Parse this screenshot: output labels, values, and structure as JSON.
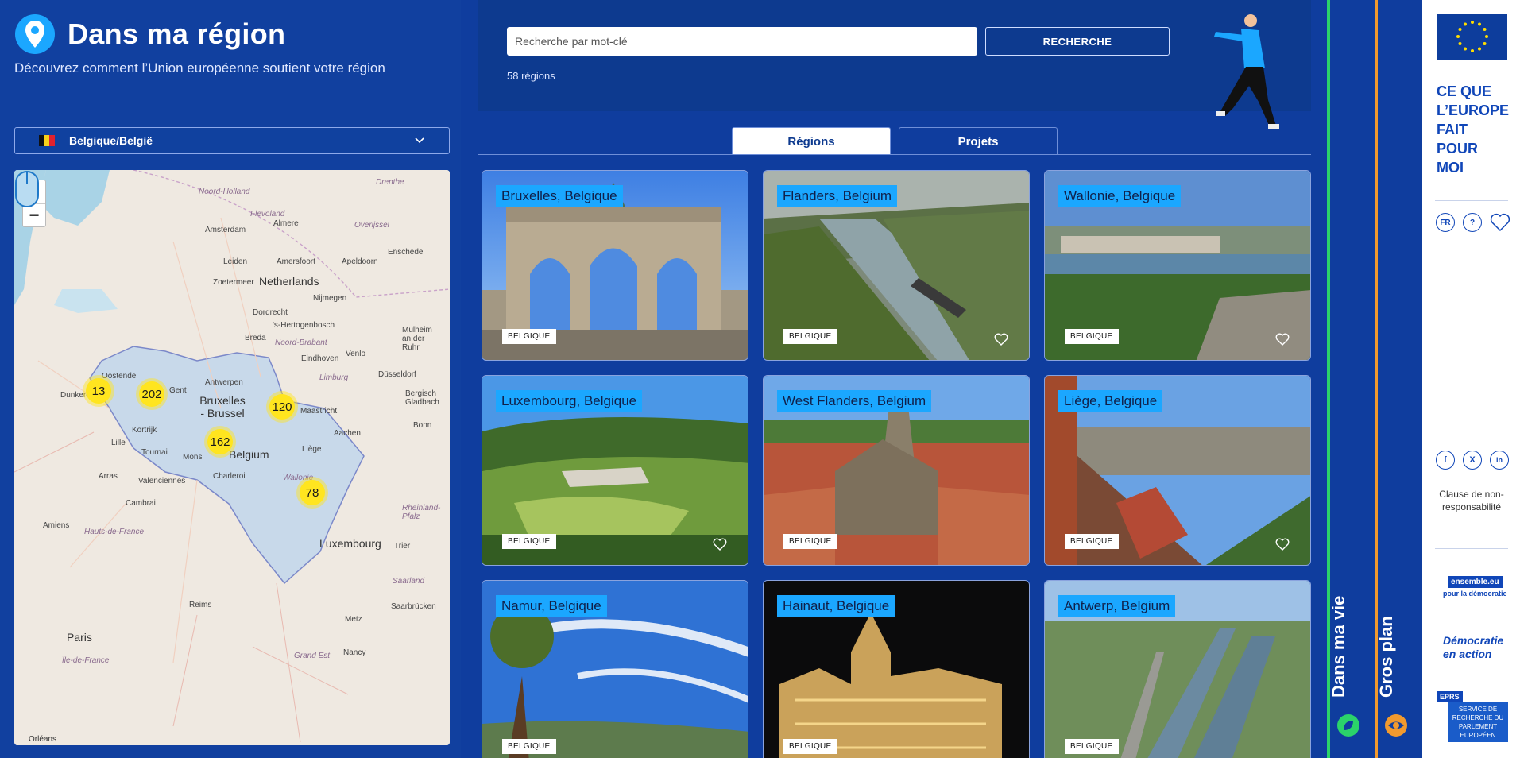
{
  "header": {
    "title": "Dans ma région",
    "subtitle": "Découvrez comment l’Union européenne soutient votre région"
  },
  "country_select": {
    "value": "Belgique/België"
  },
  "map": {
    "zoom_in": "+",
    "zoom_out": "−",
    "clusters": [
      "13",
      "202",
      "120",
      "162",
      "78"
    ],
    "places": [
      "Drenthe",
      "Noord-Holland",
      "Flevoland",
      "Amsterdam",
      "Almere",
      "Overijssel",
      "Leiden",
      "Enschede",
      "Amersfoort",
      "Apeldoorn",
      "Zoetermeer",
      "Netherlands",
      "Nijmegen",
      "Dordrecht",
      "'s-Hertogenbosch",
      "Breda",
      "Noord-Brabant",
      "Venlo",
      "Mülheim an der Ruhr",
      "Eindhoven",
      "Oostende",
      "Antwerpen",
      "Limburg",
      "Düsseldorf",
      "Dunkerque",
      "Gent",
      "Bruxelles - Brussel",
      "Maastricht",
      "Bergisch Gladbach",
      "Kortrijk",
      "Aachen",
      "Lille",
      "Tournai",
      "Mons",
      "Belgium",
      "Liège",
      "Bonn",
      "Arras",
      "Valenciennes",
      "Charleroi",
      "Wallonie",
      "Cambrai",
      "Rheinland-Pfalz",
      "Amiens",
      "Hauts-de-France",
      "Luxembourg",
      "Trier",
      "Reims",
      "Saarland",
      "Metz",
      "Saarbrücken",
      "Paris",
      "Île-de-France",
      "Grand Est",
      "Nancy",
      "Orléans"
    ]
  },
  "search": {
    "placeholder": "Recherche par mot-clé",
    "button": "RECHERCHE",
    "count": "58 régions"
  },
  "tabs": [
    "Régions",
    "Projets"
  ],
  "cards": [
    {
      "title": "Bruxelles, Belgique",
      "badge": "BELGIQUE"
    },
    {
      "title": "Flanders, Belgium",
      "badge": "BELGIQUE"
    },
    {
      "title": "Wallonie, Belgique",
      "badge": "BELGIQUE"
    },
    {
      "title": "Luxembourg, Belgique",
      "badge": "BELGIQUE"
    },
    {
      "title": "West Flanders, Belgium",
      "badge": "BELGIQUE"
    },
    {
      "title": "Liège, Belgique",
      "badge": "BELGIQUE"
    },
    {
      "title": "Namur, Belgique",
      "badge": "BELGIQUE"
    },
    {
      "title": "Hainaut, Belgique",
      "badge": "BELGIQUE"
    },
    {
      "title": "Antwerp, Belgium",
      "badge": "BELGIQUE"
    }
  ],
  "vertical_tabs": [
    {
      "label": "Dans ma vie",
      "accent": "#2bd36a"
    },
    {
      "label": "Gros plan",
      "accent": "#f29a2e"
    }
  ],
  "sidebar": {
    "brand": [
      "CE QUE",
      "L’EUROPE",
      "FAIT",
      "POUR",
      "MOI"
    ],
    "lang": "FR",
    "disclaimer": "Clause de non-responsabilité",
    "ensemble": "ensemble.eu",
    "ensemble_sub": "pour la démocratie",
    "demo_line1": "Démocratie",
    "demo_line2": "en action",
    "eprs_tag": "EPRS",
    "eprs_text": "SERVICE DE RECHERCHE DU PARLEMENT EUROPÉEN"
  },
  "colors": {
    "background": "#0f3d9e",
    "tag": "#1ba7ff",
    "cluster": "#ffe51f"
  }
}
